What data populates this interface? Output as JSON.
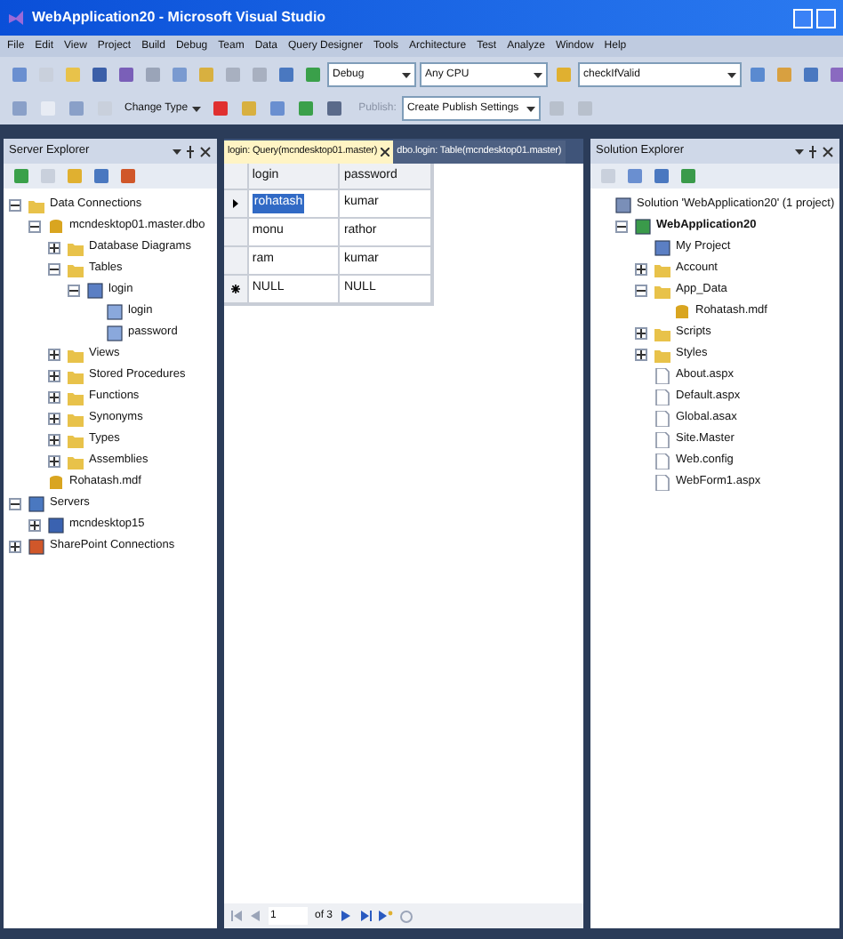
{
  "window": {
    "title": "WebApplication20 - Microsoft Visual Studio"
  },
  "menu": [
    "File",
    "Edit",
    "View",
    "Project",
    "Build",
    "Debug",
    "Team",
    "Data",
    "Query Designer",
    "Tools",
    "Architecture",
    "Test",
    "Analyze",
    "Window",
    "Help"
  ],
  "toolbar": {
    "configuration": "Debug",
    "platform": "Any CPU",
    "find": "checkIfValid",
    "change_type": "Change Type",
    "publish_label": "Publish:",
    "publish_settings": "Create Publish Settings"
  },
  "server_explorer": {
    "title": "Server Explorer",
    "tree": [
      {
        "label": "Data Connections",
        "kind": "folder",
        "expanded": true,
        "children": [
          {
            "label": "mcndesktop01.master.dbo",
            "kind": "database",
            "expanded": true,
            "children": [
              {
                "label": "Database Diagrams",
                "kind": "folder",
                "expanded": false
              },
              {
                "label": "Tables",
                "kind": "folder",
                "expanded": true,
                "children": [
                  {
                    "label": "login",
                    "kind": "table",
                    "expanded": true,
                    "children": [
                      {
                        "label": "login",
                        "kind": "column"
                      },
                      {
                        "label": "password",
                        "kind": "column"
                      }
                    ]
                  }
                ]
              },
              {
                "label": "Views",
                "kind": "folder",
                "expanded": false
              },
              {
                "label": "Stored Procedures",
                "kind": "folder",
                "expanded": false
              },
              {
                "label": "Functions",
                "kind": "folder",
                "expanded": false
              },
              {
                "label": "Synonyms",
                "kind": "folder",
                "expanded": false
              },
              {
                "label": "Types",
                "kind": "folder",
                "expanded": false
              },
              {
                "label": "Assemblies",
                "kind": "folder",
                "expanded": false
              }
            ]
          },
          {
            "label": "Rohatash.mdf",
            "kind": "database"
          }
        ]
      },
      {
        "label": "Servers",
        "kind": "server",
        "expanded": true,
        "children": [
          {
            "label": "mcndesktop15",
            "kind": "computer",
            "expanded": false
          }
        ]
      },
      {
        "label": "SharePoint Connections",
        "kind": "sharepoint",
        "expanded": false
      }
    ]
  },
  "tabs": [
    {
      "label": "login: Query(mcndesktop01.master)",
      "selected": true
    },
    {
      "label": "dbo.login: Table(mcndesktop01.master)",
      "selected": false
    }
  ],
  "grid": {
    "columns": [
      "login",
      "password"
    ],
    "rows": [
      {
        "kind": "current",
        "cells": [
          {
            "text": "rohatash",
            "selected": true
          },
          {
            "text": "kumar",
            "selected": false
          }
        ]
      },
      {
        "kind": "plain",
        "cells": [
          {
            "text": "monu",
            "selected": false
          },
          {
            "text": "rathor",
            "selected": false
          }
        ]
      },
      {
        "kind": "plain",
        "cells": [
          {
            "text": "ram",
            "selected": false
          },
          {
            "text": "kumar",
            "selected": false
          }
        ]
      },
      {
        "kind": "new",
        "cells": [
          {
            "text": "NULL",
            "selected": false
          },
          {
            "text": "NULL",
            "selected": false
          }
        ]
      }
    ]
  },
  "navigator": {
    "record": "1",
    "of": "of 3"
  },
  "solution_explorer": {
    "title": "Solution Explorer",
    "tree": [
      {
        "label": "Solution 'WebApplication20' (1 project)",
        "kind": "solution",
        "children": [
          {
            "label": "WebApplication20",
            "kind": "project",
            "bold": true,
            "expanded": true,
            "children": [
              {
                "label": "My Project",
                "kind": "myproject"
              },
              {
                "label": "Account",
                "kind": "folder",
                "expanded": false
              },
              {
                "label": "App_Data",
                "kind": "folder",
                "expanded": true,
                "children": [
                  {
                    "label": "Rohatash.mdf",
                    "kind": "database"
                  }
                ]
              },
              {
                "label": "Scripts",
                "kind": "folder",
                "expanded": false
              },
              {
                "label": "Styles",
                "kind": "folder",
                "expanded": false
              },
              {
                "label": "About.aspx",
                "kind": "file"
              },
              {
                "label": "Default.aspx",
                "kind": "file"
              },
              {
                "label": "Global.asax",
                "kind": "file"
              },
              {
                "label": "Site.Master",
                "kind": "file"
              },
              {
                "label": "Web.config",
                "kind": "file"
              },
              {
                "label": "WebForm1.aspx",
                "kind": "file"
              }
            ]
          }
        ]
      }
    ]
  }
}
